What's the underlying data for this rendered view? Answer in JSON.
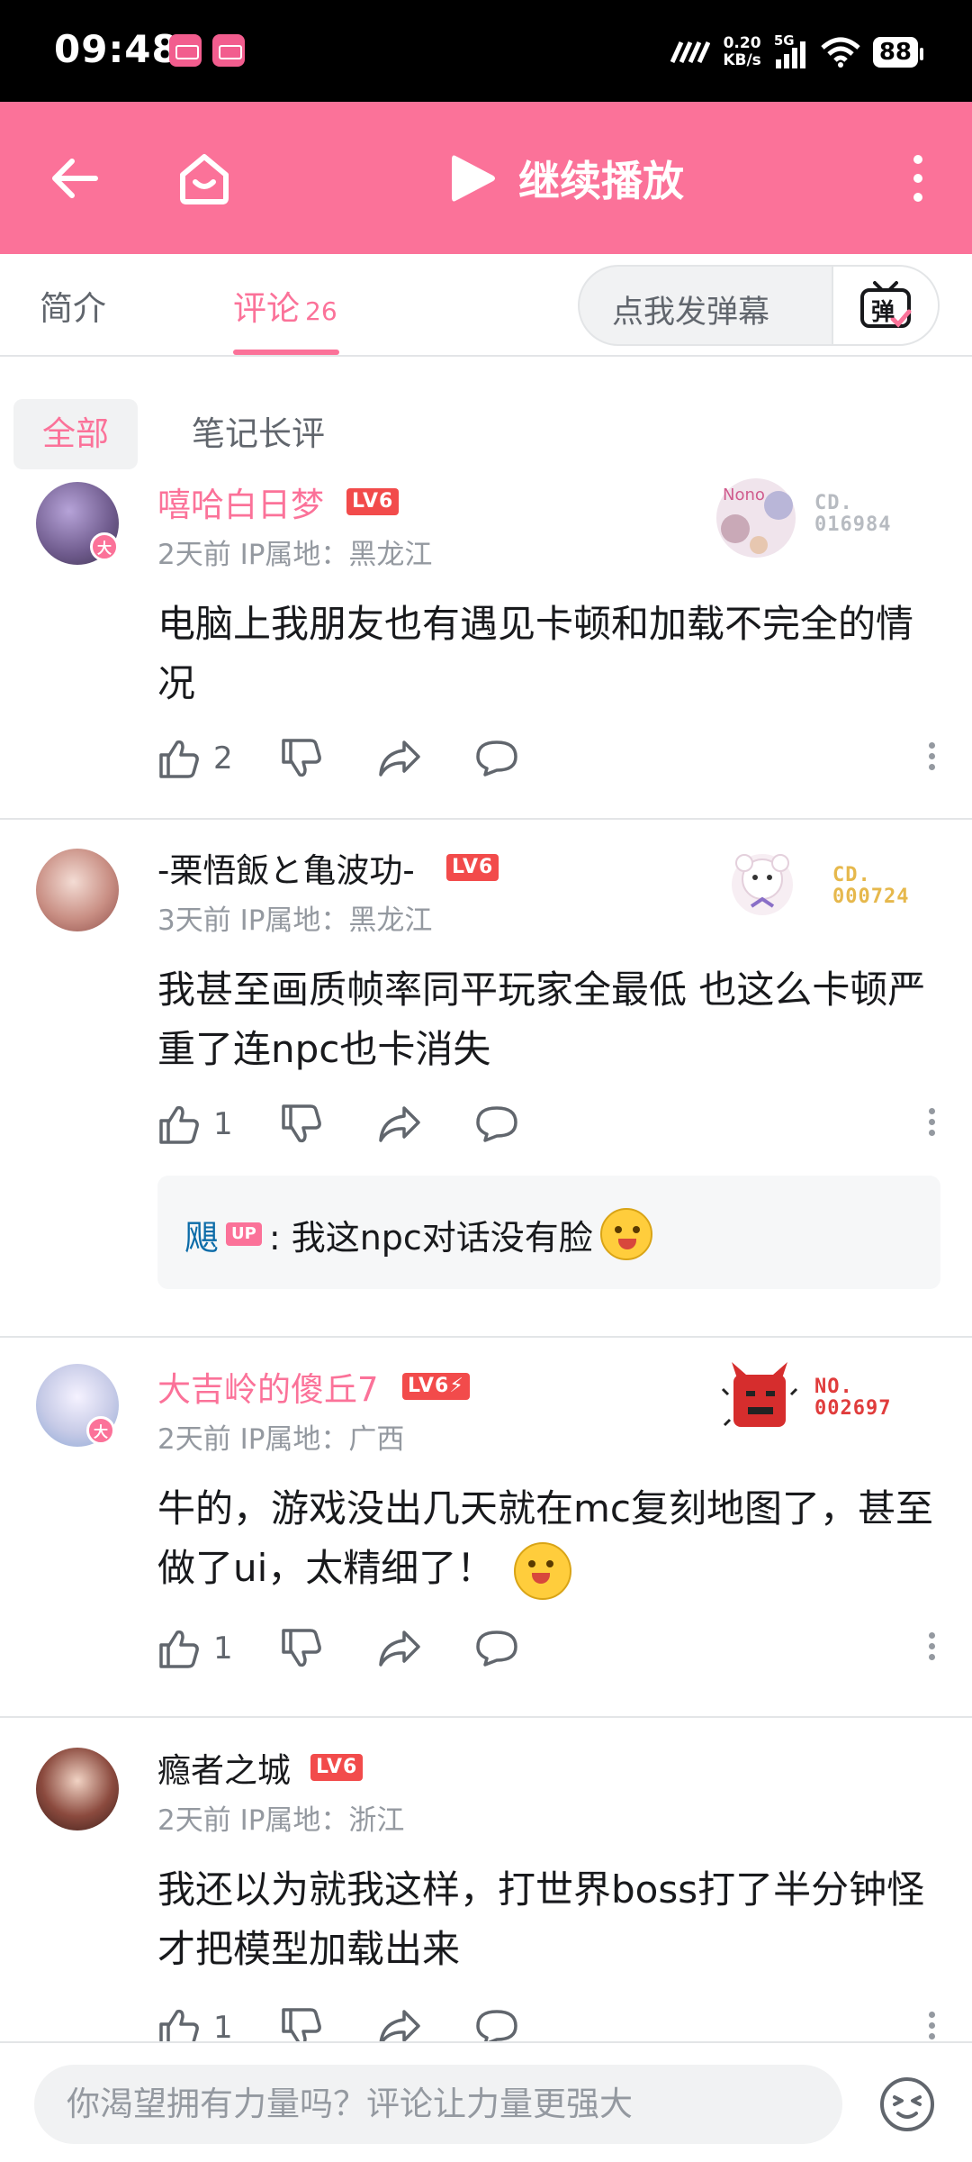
{
  "status_bar": {
    "time": "09:48",
    "speed_value": "0.20",
    "speed_unit": "KB/s",
    "network": "5G",
    "battery": "88"
  },
  "top_bar": {
    "continue_label": "继续播放"
  },
  "tabs": {
    "intro": "简介",
    "comments": "评论",
    "comments_count": "26",
    "danmaku_placeholder": "点我发弹幕",
    "danmaku_button": "弹"
  },
  "filters": {
    "all": "全部",
    "notes": "笔记长评"
  },
  "comments": [
    {
      "username": "嘻哈白日梦",
      "level": "LV6",
      "vip_badge": "大",
      "meta": "2天前 IP属地：黑龙江",
      "text": "电脑上我朋友也有遇见卡顿和加载不完全的情况",
      "likes": "2",
      "fan_number": "CD.\n016984",
      "fan_color": "#b7bbc1"
    },
    {
      "username": "-栗悟飯と亀波功-",
      "level": "LV6",
      "meta": "3天前 IP属地：黑龙江",
      "text": "我甚至画质帧率同平玩家全最低 也这么卡顿严重了连npc也卡消失",
      "likes": "1",
      "fan_number": "CD.\n000724",
      "fan_color": "#e6b84c",
      "reply": {
        "user": "飓",
        "up_tag": "UP",
        "text": ": 我这npc对话没有脸"
      }
    },
    {
      "username": "大吉岭的傻丘7",
      "level": "LV6⚡",
      "vip_badge": "大",
      "meta": "2天前 IP属地：广西",
      "text": "牛的，游戏没出几天就在mc复刻地图了，甚至做了ui，太精细了！",
      "likes": "1",
      "fan_number": "NO.\n002697",
      "fan_color": "#e03c3c"
    },
    {
      "username": "瘾者之城",
      "level": "LV6",
      "meta": "2天前 IP属地：浙江",
      "text": "我还以为就我这样，打世界boss打了半分钟怪才把模型加载出来",
      "likes": "1"
    }
  ],
  "bottom_bar": {
    "input_placeholder": "你渴望拥有力量吗？评论让力量更强大"
  },
  "colors": {
    "brand_pink": "#fb7299",
    "level_red": "#f24b4b",
    "text_secondary": "#9499a0",
    "link_blue": "#0b6ba8"
  }
}
